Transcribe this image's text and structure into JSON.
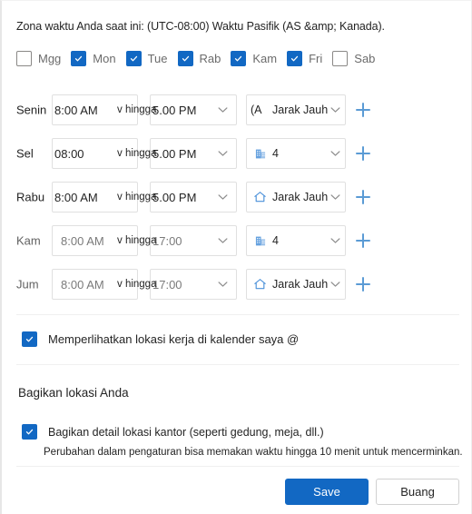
{
  "timezone_note": "Zona waktu Anda saat ini: (UTC-08:00) Waktu Pasifik (AS &amp; Kanada).",
  "day_toggles": [
    {
      "label": "Mgg",
      "checked": false
    },
    {
      "label": "Mon",
      "checked": true
    },
    {
      "label": "Tue",
      "checked": true
    },
    {
      "label": "Rab",
      "checked": true
    },
    {
      "label": "Kam",
      "checked": true
    },
    {
      "label": "Fri",
      "checked": true
    },
    {
      "label": "Sab",
      "checked": false
    }
  ],
  "connector_label": "v hingga",
  "schedule_rows": [
    {
      "day": "Senin",
      "start": "8:00 AM",
      "end": "5.00 PM",
      "location_icon": "clipped-icon",
      "location_prefix": "(A",
      "location": "Jarak Jauh",
      "dim": false
    },
    {
      "day": "Sel",
      "start": "08:00",
      "end": "5.00 PM",
      "location_icon": "building-icon",
      "location_prefix": "",
      "location": "4",
      "dim": false
    },
    {
      "day": "Rabu",
      "start": "8:00 AM",
      "end": "5.00 PM",
      "location_icon": "home-icon",
      "location_prefix": "",
      "location": "Jarak Jauh",
      "dim": false
    },
    {
      "day": "Kam",
      "start": "8:00 AM",
      "end": "17:00",
      "location_icon": "building-icon",
      "location_prefix": "",
      "location": "4",
      "dim": true
    },
    {
      "day": "Jum",
      "start": "8:00 AM",
      "end": "17:00",
      "location_icon": "home-icon",
      "location_prefix": "",
      "location": "Jarak Jauh",
      "dim": true
    }
  ],
  "calendar_option": {
    "label": "Memperlihatkan lokasi kerja di kalender saya @",
    "checked": true
  },
  "share_section": {
    "title": "Bagikan lokasi Anda",
    "option_label": "Bagikan detail lokasi kantor (seperti gedung, meja, dll.)",
    "option_checked": true,
    "note": "Perubahan dalam pengaturan bisa memakan waktu hingga 10 menit untuk mencerminkan."
  },
  "footer": {
    "save_label": "Save",
    "discard_label": "Buang"
  },
  "colors": {
    "accent": "#1268c3",
    "plus": "#5b9bd5",
    "icon_blue": "#4a90d9"
  }
}
